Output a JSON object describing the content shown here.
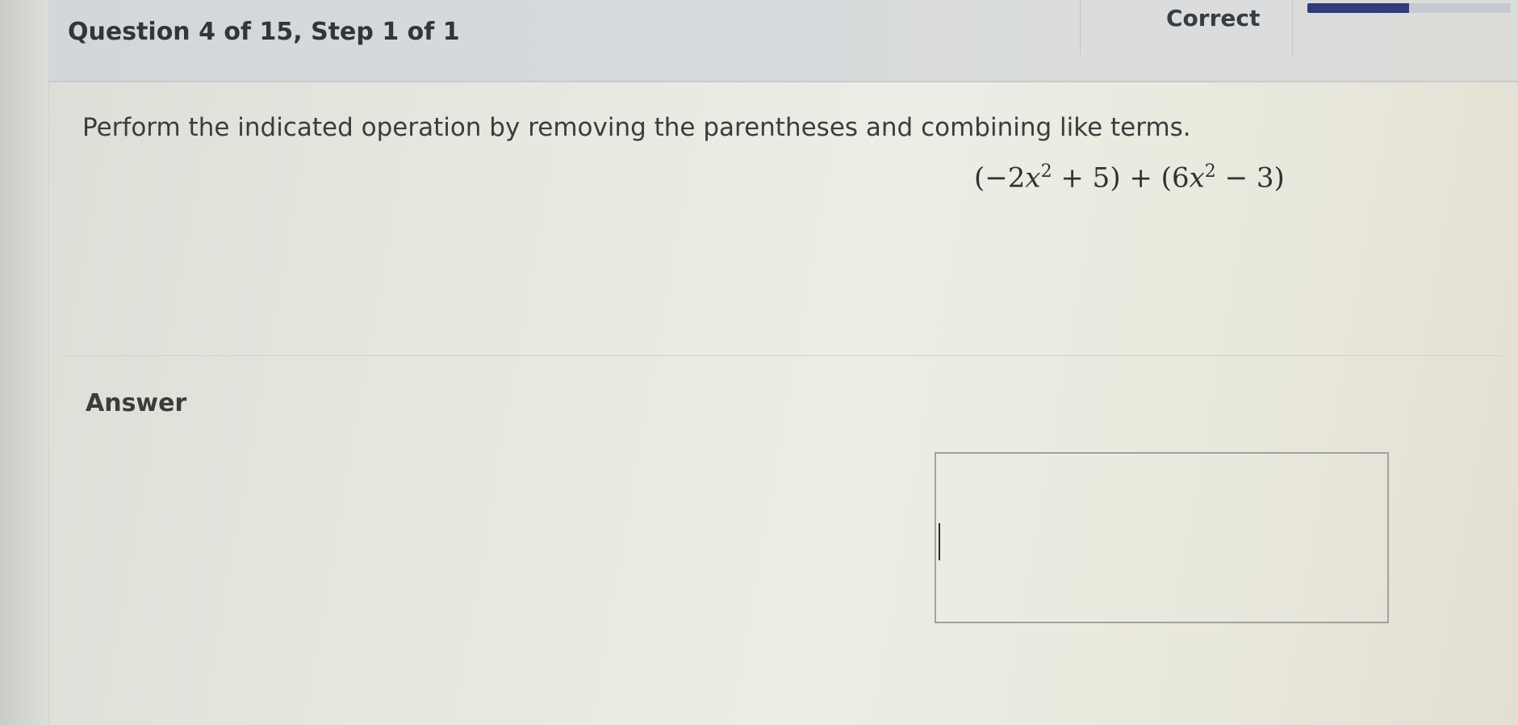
{
  "header": {
    "title": "Question 4 of 15, Step 1 of 1",
    "status": "Correct"
  },
  "progress": {
    "fraction": 0.5,
    "color": "#2f3d7a"
  },
  "question": {
    "prompt": "Perform the indicated operation by removing the parentheses and combining like terms.",
    "expression": {
      "open1": "(−2",
      "var1": "x",
      "exp1": "2",
      "rest1": " + 5) + (6",
      "var2": "x",
      "exp2": "2",
      "rest2": " − 3)"
    }
  },
  "answer": {
    "label": "Answer",
    "value": ""
  }
}
